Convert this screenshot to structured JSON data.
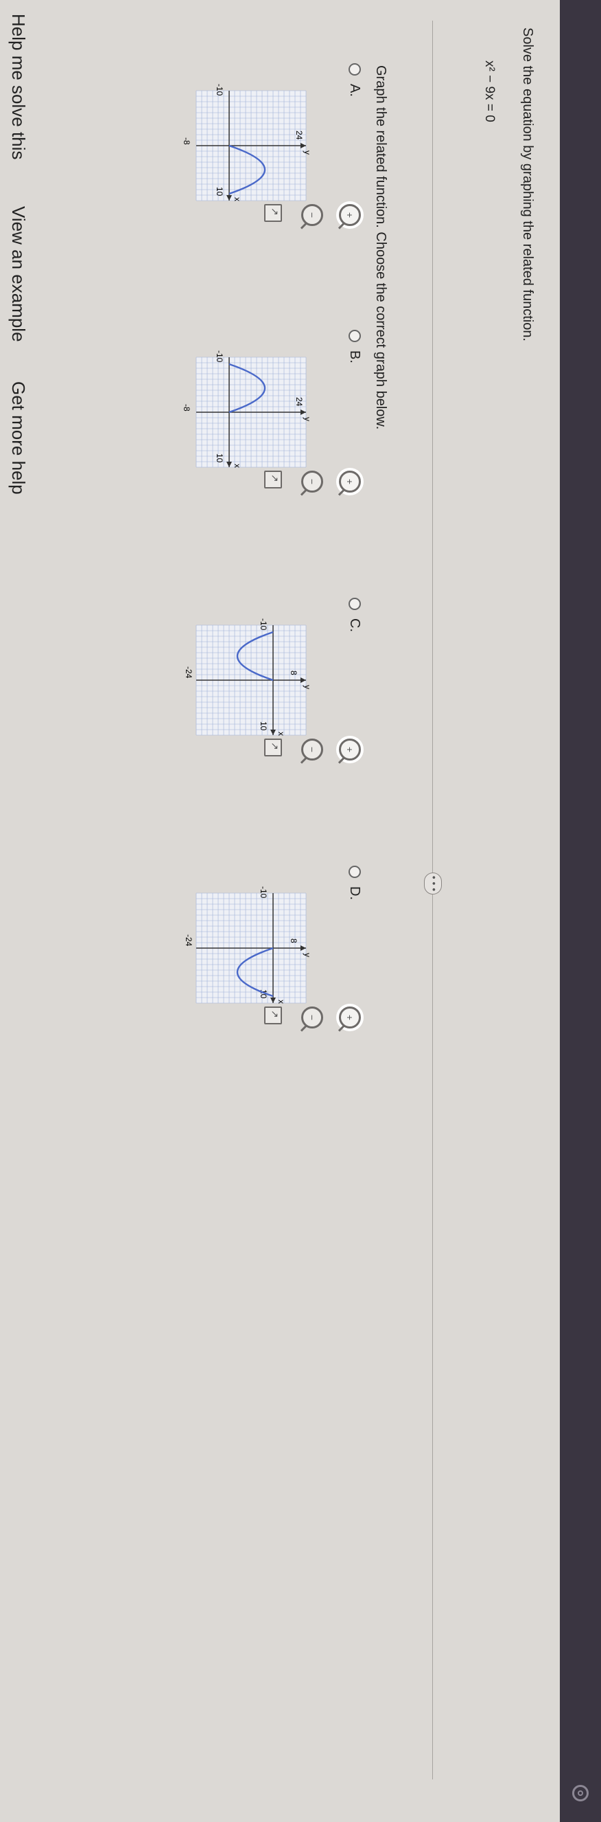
{
  "question": {
    "prompt": "Solve the equation by graphing the related function.",
    "equation": "x² − 9x = 0",
    "instruction": "Graph the related function. Choose the correct graph below.",
    "more_label": "• • •"
  },
  "options": [
    {
      "letter": "A.",
      "ytop": "24",
      "ybot": "-8",
      "xleft": "-10",
      "xright": "10",
      "xvar": "x",
      "yvar": "y"
    },
    {
      "letter": "B.",
      "ytop": "24",
      "ybot": "-8",
      "xleft": "-10",
      "xright": "10",
      "xvar": "x",
      "yvar": "y"
    },
    {
      "letter": "C.",
      "ytop": "8",
      "ybot": "-24",
      "xleft": "-10",
      "xright": "10",
      "xvar": "x",
      "yvar": "y"
    },
    {
      "letter": "D.",
      "ytop": "8",
      "ybot": "-24",
      "xleft": "-10",
      "xright": "10",
      "xvar": "x",
      "yvar": "y"
    }
  ],
  "footer": {
    "help": "Help me solve this",
    "example": "View an example",
    "more": "Get more help"
  },
  "colors": {
    "curve": "#4a69c9",
    "grid": "#9fb1d8",
    "background": "#dcd9d5"
  },
  "icons": [
    "zoom-in-icon",
    "zoom-out-icon",
    "expand-graph-icon",
    "settings-gear-icon"
  ]
}
